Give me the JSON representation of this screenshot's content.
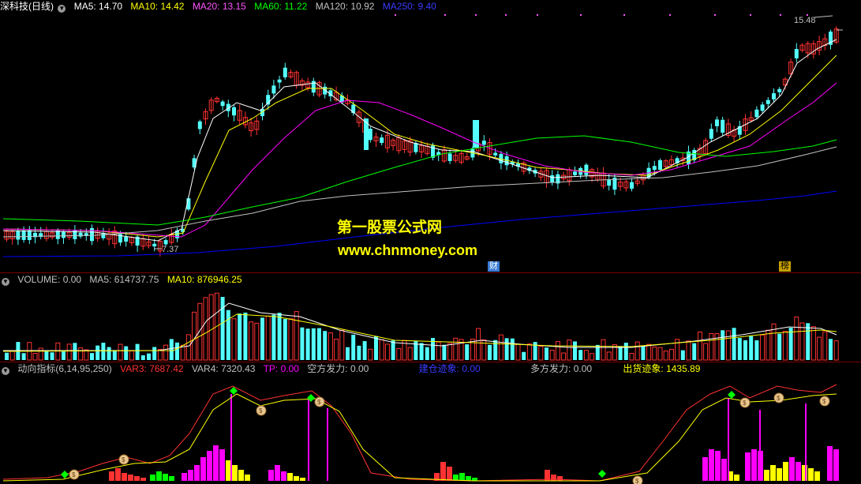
{
  "colors": {
    "bg": "#000000",
    "up": "#ff3232",
    "down": "#54ffff",
    "ma5": "#ffffff",
    "ma10": "#ffff00",
    "ma20": "#ff00ff",
    "ma60": "#00ff00",
    "ma120": "#c0c0c0",
    "ma250": "#0000ff",
    "divider": "#7a0000",
    "tag_bg": "#3a7bd5",
    "tag_bg2": "#c8a000"
  },
  "price_panel": {
    "title_icon": "chevron-down-icon",
    "stock": "深科技",
    "period": "(日线)",
    "indicators": [
      {
        "label": "MA5: 14.70",
        "color": "#ffffff"
      },
      {
        "label": "MA10: 14.42",
        "color": "#ffff00"
      },
      {
        "label": "MA20: 13.15",
        "color": "#ff55ff"
      },
      {
        "label": "MA60: 11.22",
        "color": "#00ff00"
      },
      {
        "label": "MA120: 10.92",
        "color": "#c0c0c0"
      },
      {
        "label": "MA250: 9.40",
        "color": "#3a3aff"
      }
    ],
    "high_label": "15.48",
    "low_label": "7.37",
    "tag_cai": "财",
    "tag_bang": "榜",
    "watermark_cn": "第一股票公式网",
    "watermark_url": "www.chnmoney.com"
  },
  "volume_panel": {
    "title_icon": "chevron-down-icon",
    "indicators": [
      {
        "label": "VOLUME: 0.00",
        "color": "#c0c0c0"
      },
      {
        "label": "MA5: 614737.75",
        "color": "#c0c0c0"
      },
      {
        "label": "MA10: 876946.25",
        "color": "#ffff00"
      }
    ]
  },
  "indicator_panel": {
    "title_icon": "chevron-down-icon",
    "indicators": [
      {
        "label": "动向指标(6,14,95,250)",
        "color": "#c0c0c0"
      },
      {
        "label": "VAR3: 7687.42",
        "color": "#ff3232"
      },
      {
        "label": "VAR4: 7320.43",
        "color": "#c0c0c0"
      },
      {
        "label": "TP: 0.00",
        "color": "#ff00ff"
      },
      {
        "label": "空方发力: 0.00",
        "color": "#c0c0c0"
      },
      {
        "label": "建仓迹象: 0.00",
        "color": "#3a3aff"
      },
      {
        "label": "多方发力: 0.00",
        "color": "#c0c0c0"
      },
      {
        "label": "出货迹象: 1435.89",
        "color": "#ffff00"
      }
    ]
  }
}
